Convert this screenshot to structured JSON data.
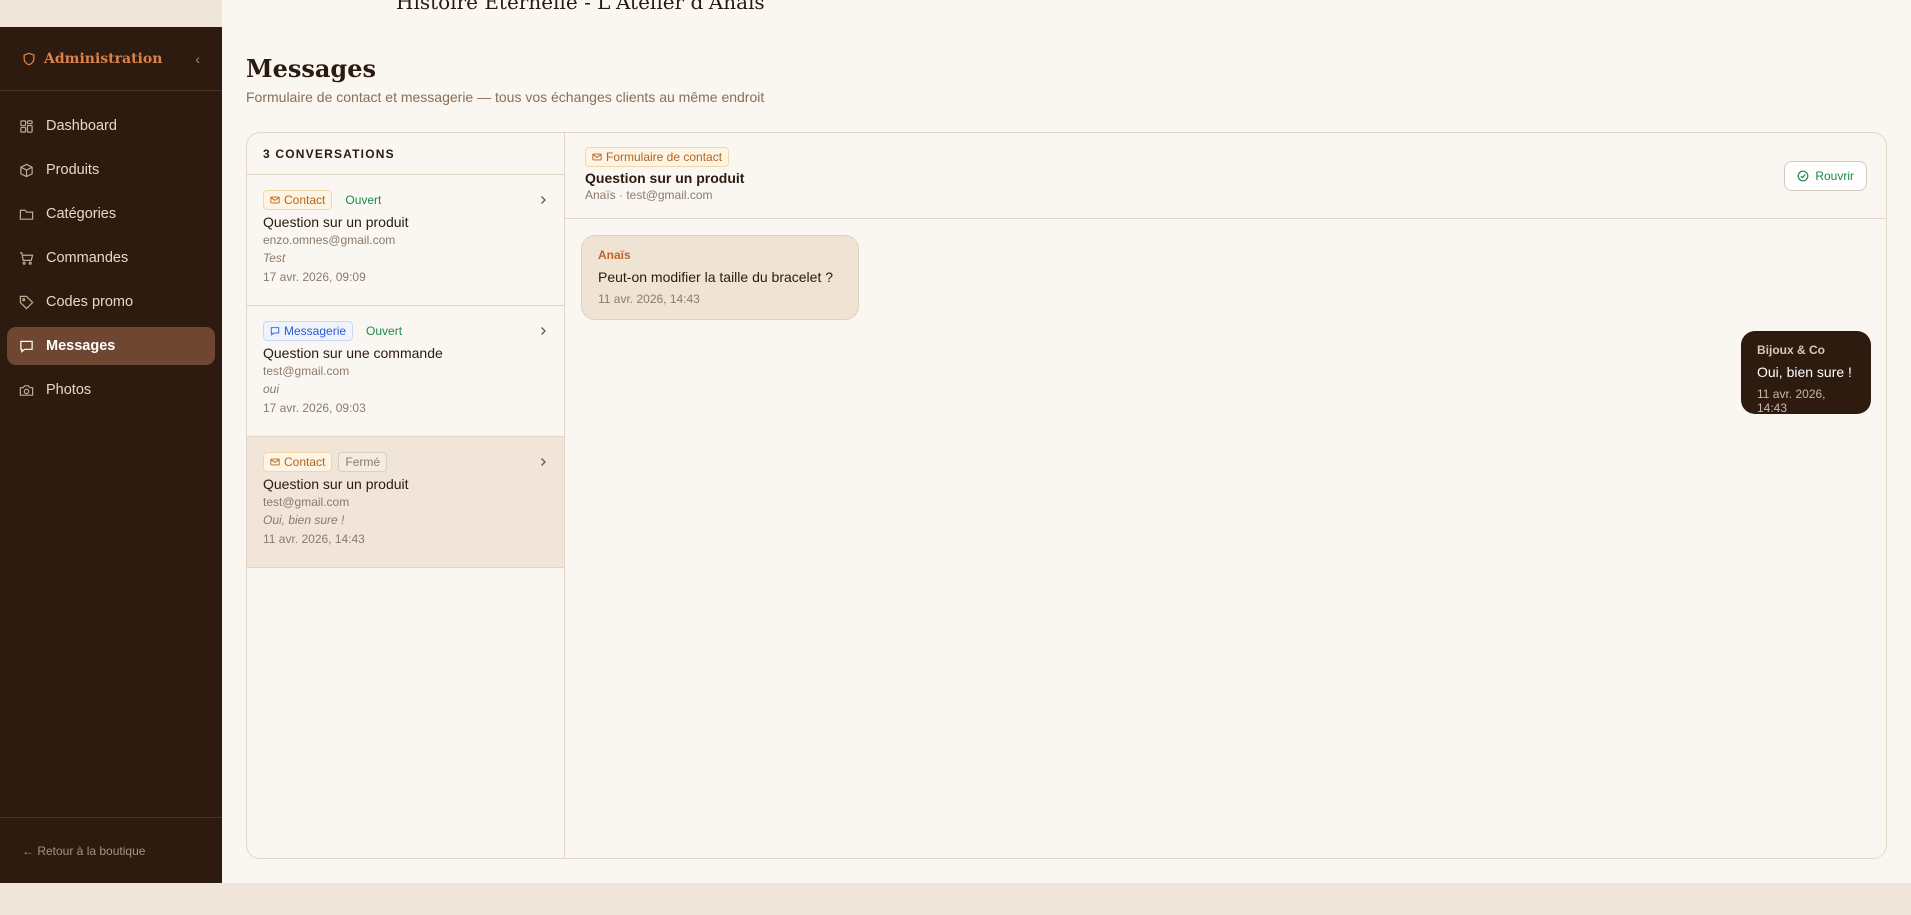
{
  "topbar": {
    "title": "Histoire Eternelle - L'Atelier d'Anaïs"
  },
  "sidebar": {
    "title": "Administration",
    "items": [
      {
        "label": "Dashboard",
        "icon": "dashboard-icon"
      },
      {
        "label": "Produits",
        "icon": "box-icon"
      },
      {
        "label": "Catégories",
        "icon": "folder-icon"
      },
      {
        "label": "Commandes",
        "icon": "cart-icon"
      },
      {
        "label": "Codes promo",
        "icon": "tag-icon"
      },
      {
        "label": "Messages",
        "icon": "message-icon",
        "active": true
      },
      {
        "label": "Photos",
        "icon": "camera-icon"
      }
    ],
    "back_label": "← Retour à la boutique"
  },
  "page": {
    "title": "Messages",
    "subtitle": "Formulaire de contact et messagerie — tous vos échanges clients au même endroit"
  },
  "list": {
    "header": "3 CONVERSATIONS",
    "conversations": [
      {
        "type": "Contact",
        "status": "Ouvert",
        "subject": "Question sur un produit",
        "email": "enzo.omnes@gmail.com",
        "preview": "Test",
        "date": "17 avr. 2026, 09:09"
      },
      {
        "type": "Messagerie",
        "status": "Ouvert",
        "subject": "Question sur une commande",
        "email": "test@gmail.com",
        "preview": "oui",
        "date": "17 avr. 2026, 09:03"
      },
      {
        "type": "Contact",
        "status": "Fermé",
        "subject": "Question sur un produit",
        "email": "test@gmail.com",
        "preview": "Oui, bien sure !",
        "date": "11 avr. 2026, 14:43"
      }
    ]
  },
  "thread": {
    "source_tag": "Formulaire de contact",
    "subject": "Question sur un produit",
    "meta": "Anaïs · test@gmail.com",
    "reopen_label": "Rouvrir",
    "messages": [
      {
        "author": "Anaïs",
        "text": "Peut-on modifier la taille du bracelet ?",
        "date": "11 avr. 2026, 14:43"
      },
      {
        "author": "Bijoux & Co",
        "text": "Oui, bien sure !",
        "date": "11 avr. 2026, 14:43"
      }
    ]
  },
  "colors": {
    "sidebar_bg": "#2e1b10",
    "accent": "#d9824a",
    "active_bg": "#6e4631",
    "open_green": "#1c8a4a"
  }
}
